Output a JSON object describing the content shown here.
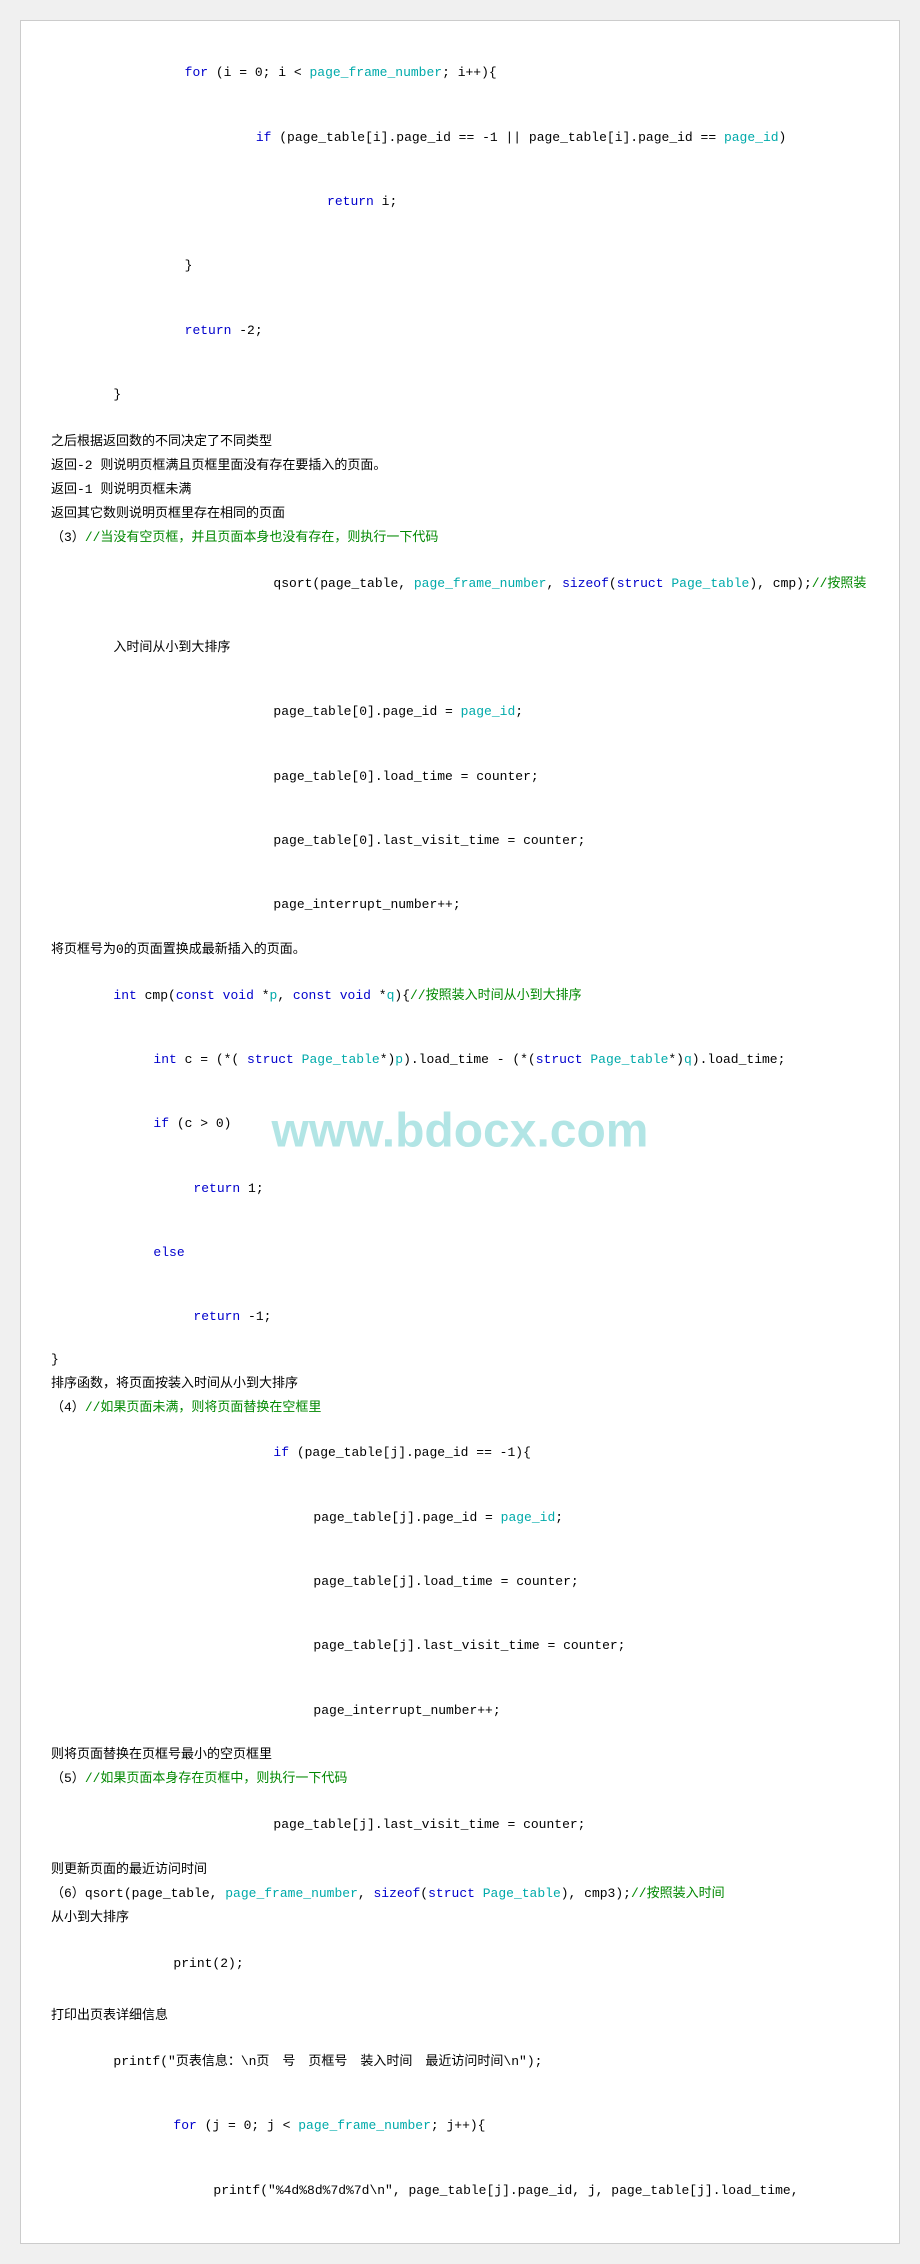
{
  "page": {
    "background": "#ffffff",
    "watermark": "www.bdocx.com"
  },
  "code_sections": [
    {
      "id": "section1",
      "lines": [
        {
          "type": "code",
          "indent": 1,
          "content": "for (i = 0; i < page_frame_number; i++){"
        },
        {
          "type": "code",
          "indent": 2,
          "content": "if (page_table[i].page_id == -1 || page_table[i].page_id == page_id)"
        },
        {
          "type": "code",
          "indent": 3,
          "content": "return i;"
        },
        {
          "type": "code",
          "indent": 1,
          "content": "}"
        },
        {
          "type": "code",
          "indent": 1,
          "content": "return -2;"
        },
        {
          "type": "code",
          "indent": 0,
          "content": "}"
        }
      ]
    }
  ],
  "prose_sections": [
    {
      "id": "p1",
      "text": "之后根据返回数的不同决定了不同类型"
    },
    {
      "id": "p2",
      "text": "返回-2 则说明页框满且页框里面没有存在要插入的页面。"
    },
    {
      "id": "p3",
      "text": "返回-1 则说明页框未满"
    },
    {
      "id": "p4",
      "text": "返回其它数则说明页框里存在相同的页面"
    },
    {
      "id": "p5",
      "text": "（3）//当没有空页框，并且页面本身也没有存在，则执行一下代码",
      "has_comment": true
    },
    {
      "id": "p6",
      "text": "qsort(page_table, page_frame_number, sizeof(struct Page_table), cmp);//按照装入时间从小到大排序",
      "indent": 4
    },
    {
      "id": "p7",
      "text": "page_table[0].page_id = page_id;",
      "indent": 4
    },
    {
      "id": "p8",
      "text": "page_table[0].load_time = counter;",
      "indent": 4
    },
    {
      "id": "p9",
      "text": "page_table[0].last_visit_time = counter;",
      "indent": 4
    },
    {
      "id": "p10",
      "text": "page_interrupt_number++;",
      "indent": 4
    },
    {
      "id": "p11",
      "text": "将页框号为0的页面置换成最新插入的页面。"
    },
    {
      "id": "p12",
      "text": "int cmp(const void *p, const void *q){//按照装入时间从小到大排序",
      "has_code": true
    },
    {
      "id": "p13",
      "text": "int c = (*(struct Page_table*)p).load_time - (*(struct Page_table*)q).load_time;",
      "indent": 2
    },
    {
      "id": "p14",
      "text": "if (c > 0)",
      "indent": 2
    },
    {
      "id": "p15",
      "text": "return 1;",
      "indent": 3
    },
    {
      "id": "p16",
      "text": "else",
      "indent": 2
    },
    {
      "id": "p17",
      "text": "return -1;",
      "indent": 3
    },
    {
      "id": "p18",
      "text": "}"
    },
    {
      "id": "p19",
      "text": "排序函数，将页面按装入时间从小到大排序"
    },
    {
      "id": "p20",
      "text": "（4）//如果页面未满，则将页面替换在空框里",
      "has_comment": true
    },
    {
      "id": "p21",
      "text": "if (page_table[j].page_id == -1){",
      "indent": 4
    },
    {
      "id": "p22",
      "text": "page_table[j].page_id = page_id;",
      "indent": 5
    },
    {
      "id": "p23",
      "text": "page_table[j].load_time = counter;",
      "indent": 5
    },
    {
      "id": "p24",
      "text": "page_table[j].last_visit_time = counter;",
      "indent": 5
    },
    {
      "id": "p25",
      "text": "page_interrupt_number++;",
      "indent": 5
    },
    {
      "id": "p26",
      "text": "则将页面替换在页框号最小的空页框里"
    },
    {
      "id": "p27",
      "text": "（5）//如果页面本身存在页框中，则执行一下代码",
      "has_comment": true
    },
    {
      "id": "p28",
      "text": "page_table[j].last_visit_time = counter;",
      "indent": 4
    },
    {
      "id": "p29",
      "text": "则更新页面的最近访问时间"
    },
    {
      "id": "p30",
      "text": "（6）qsort(page_table, page_frame_number, sizeof(struct Page_table), cmp3);//按照装入时间从小到大排序",
      "has_comment": true
    },
    {
      "id": "p31",
      "text": "print(2);",
      "indent": 2
    },
    {
      "id": "p32",
      "text": ""
    },
    {
      "id": "p33",
      "text": "打印出页表详细信息"
    },
    {
      "id": "p34",
      "text": "printf(\"页表信息：\\n页　号　页框号　装入时间　最近访问时间\\n\");"
    },
    {
      "id": "p35",
      "text": "for (j = 0; j < page_frame_number; j++){",
      "indent": 2
    },
    {
      "id": "p36",
      "text": "printf(\"%4d%8d%7d%7d\\n\", page_table[j].page_id, j, page_table[j].load_time,",
      "indent": 3
    }
  ]
}
